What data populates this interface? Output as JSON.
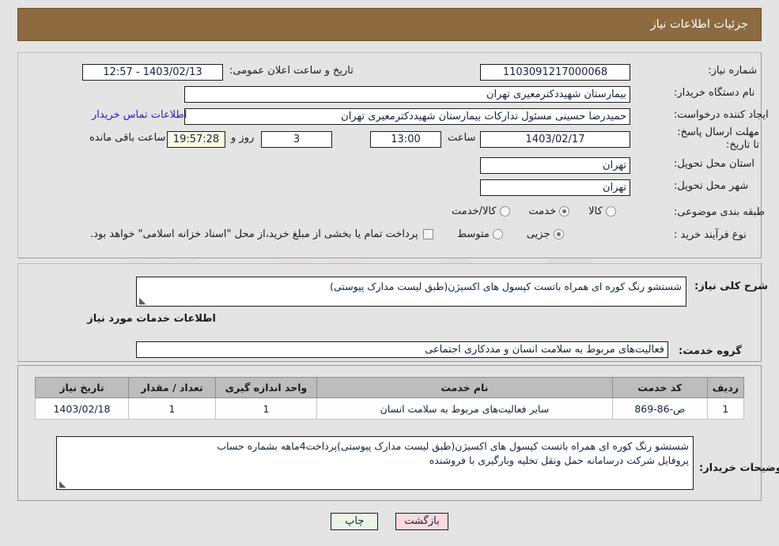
{
  "header": {
    "title": "جزئیات اطلاعات نیاز",
    "bar_color": "#8d6a3f"
  },
  "watermark": {
    "text": "AriaTender.net"
  },
  "form": {
    "need_number_label": "شماره نیاز:",
    "need_number_value": "1103091217000068",
    "public_announce_label": "تاریخ و ساعت اعلان عمومی:",
    "public_announce_value": "1403/02/13 - 12:57",
    "buyer_org_label": "نام دستگاه خریدار:",
    "buyer_org_value": "بیمارستان شهیددکترمعیری تهران",
    "requester_label": "ایجاد کننده درخواست:",
    "requester_value": "حمیدرضا حسینی مسئول تدارکات بیمارستان شهیددکترمعیری تهران",
    "contact_link": "اطلاعات تماس خریدار",
    "deadline_label": "مهلت ارسال پاسخ: تا تاریخ:",
    "deadline_date": "1403/02/17",
    "hour_label": "ساعت",
    "deadline_hour": "13:00",
    "days_value": "3",
    "days_label": "روز و",
    "timer_value": "19:57:28",
    "timer_label": "ساعت باقی مانده",
    "province_label": "استان محل تحویل:",
    "province_value": "تهران",
    "city_label": "شهر محل تحویل:",
    "city_value": "تهران",
    "category_label": "طبقه بندی موضوعی:",
    "category_options": [
      {
        "label": "کالا",
        "selected": false
      },
      {
        "label": "خدمت",
        "selected": true
      },
      {
        "label": "کالا/خدمت",
        "selected": false
      }
    ],
    "process_label": "نوع فرآیند خرید :",
    "process_options": [
      {
        "label": "جزیی",
        "selected": true
      },
      {
        "label": "متوسط",
        "selected": false
      }
    ],
    "treasury_checkbox_label": "پرداخت تمام یا بخشی از مبلغ خرید،از محل \"اسناد خزانه اسلامی\" خواهد بود.",
    "treasury_checked": false
  },
  "description": {
    "label": "شرح کلی نیاز:",
    "value": "شستشو رنگ کوره ای همراه باتست کپسول های اکسیژن(طبق لیست مدارک پیوستی)"
  },
  "services_section": {
    "heading": "اطلاعات خدمات مورد نیاز",
    "group_label": "گروه خدمت:",
    "group_value": "فعالیت‌های مربوط به سلامت انسان و مددکاری اجتماعی"
  },
  "table": {
    "columns": [
      "ردیف",
      "کد خدمت",
      "نام خدمت",
      "واحد اندازه گیری",
      "تعداد / مقدار",
      "تاریخ نیاز"
    ],
    "rows": [
      {
        "index": "1",
        "code": "ص-86-869",
        "name": "سایر فعالیت‌های مربوط به سلامت انسان",
        "unit": "1",
        "qty": "1",
        "need_date": "1403/02/18"
      }
    ]
  },
  "buyer_notes": {
    "label": "توضیحات خریدار:",
    "line1": "شستشو رنگ کوره ای همراه باتست کپسول های اکسیژن(طبق لیست مدارک پیوستی)پرداخت4ماهه بشماره حساب",
    "line2": "پروفایل شرکت درسامانه حمل ونقل  تخلیه وبارگیری با فروشنده"
  },
  "buttons": {
    "print": "چاپ",
    "back": "بازگشت"
  }
}
